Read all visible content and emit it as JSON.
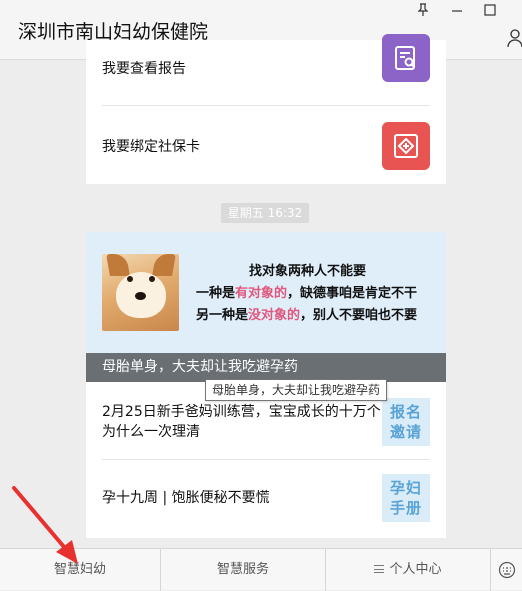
{
  "window": {
    "title": "深圳市南山妇幼保健院"
  },
  "menu": {
    "items": [
      {
        "label": "我要查看报告",
        "icon": "report-search-icon",
        "color": "#8c63c6"
      },
      {
        "label": "我要绑定社保卡",
        "icon": "social-card-icon",
        "color": "#e85451"
      }
    ]
  },
  "timestamp": "星期五 16:32",
  "article": {
    "banner": {
      "line1": "找对象两种人不能要",
      "line2_a": "一种是",
      "line2_hl": "有对象的",
      "line2_b": "，缺德事咱是肯定不干",
      "line3_a": "另一种是",
      "line3_hl": "没对象的",
      "line3_b": "，别人不要咱也不要",
      "caption": "母胎单身，大夫却让我吃避孕药"
    },
    "tooltip": "母胎单身，大夫却让我吃避孕药",
    "news": [
      {
        "title": "2月25日新手爸妈训练营，宝宝成长的十万个为什么一次理清",
        "thumb_text": "报名邀请"
      },
      {
        "title": "孕十九周 | 饱胀便秘不要慌",
        "thumb_text": "孕妇手册"
      }
    ]
  },
  "tabbar": {
    "tabs": [
      "智慧妇幼",
      "智慧服务",
      "个人中心"
    ]
  },
  "colors": {
    "annotation_arrow": "#e8312f",
    "banner_bg": "#dfeef9",
    "highlight": "#e0577d"
  }
}
